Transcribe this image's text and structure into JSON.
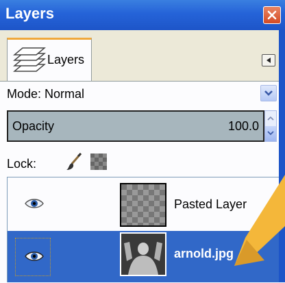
{
  "window": {
    "title": "Layers",
    "close_icon": "close-icon"
  },
  "tab": {
    "label": "Layers",
    "icon": "layers-stack-icon",
    "menu_icon": "tab-menu-icon"
  },
  "mode": {
    "label": "Mode:",
    "value": "Normal"
  },
  "opacity": {
    "label": "Opacity",
    "value": "100.0"
  },
  "lock": {
    "label": "Lock:",
    "pixels_icon": "paintbrush-icon",
    "alpha_icon": "alpha-checker-icon"
  },
  "layers": [
    {
      "name": "Pasted Layer",
      "visible": true,
      "selected": false
    },
    {
      "name": "arnold.jpg",
      "visible": true,
      "selected": true
    }
  ],
  "colors": {
    "titlebar": "#2563d8",
    "selection": "#3168c8",
    "arrow": "#f4b73a"
  }
}
